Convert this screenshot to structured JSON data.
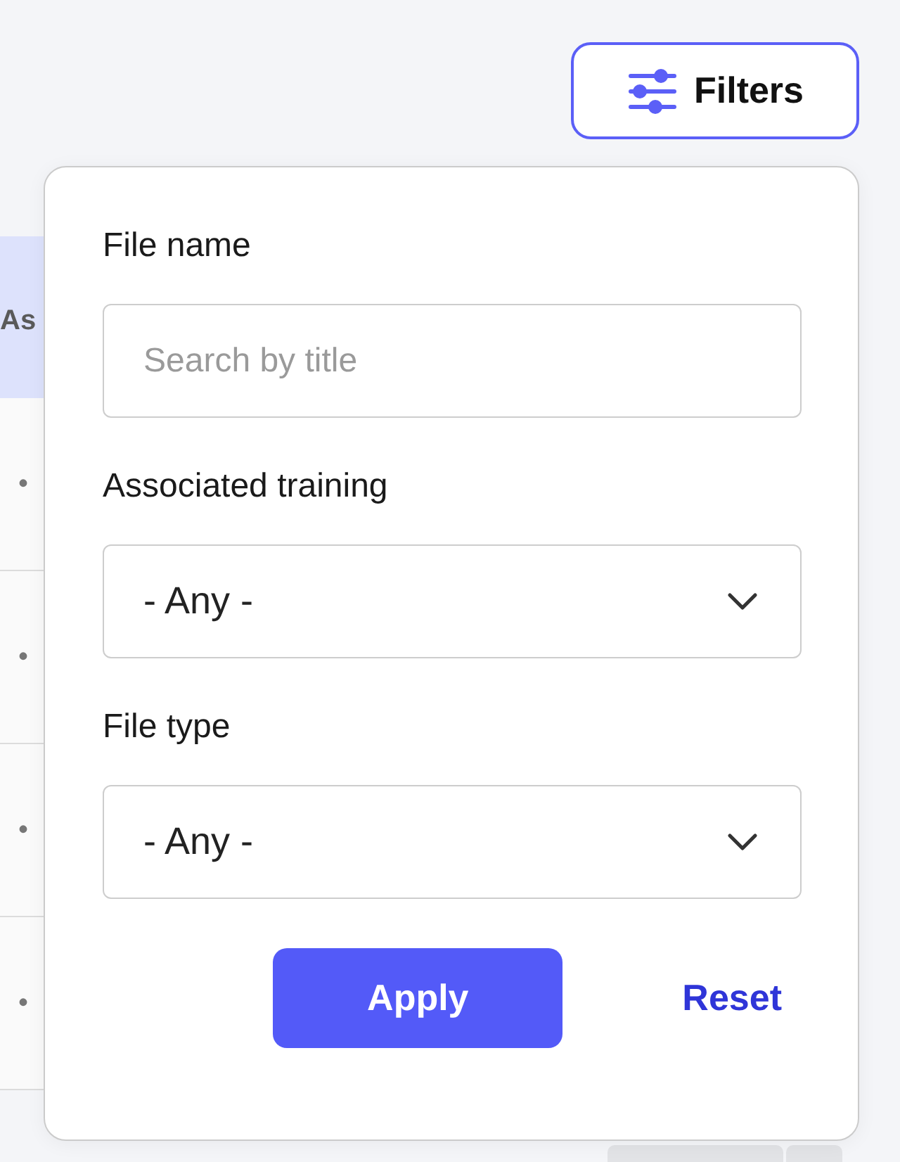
{
  "filter_button": {
    "label": "Filters",
    "expanded": true
  },
  "table": {
    "columns": [
      {
        "label": "As"
      }
    ],
    "rows": [
      {
        "cells": [
          "•"
        ]
      },
      {
        "cells": [
          "•"
        ]
      },
      {
        "cells": [
          "•"
        ]
      },
      {
        "cells": [
          "•"
        ]
      }
    ]
  },
  "filter_panel": {
    "fields": [
      {
        "kind": "text",
        "label": "File name",
        "placeholder": "Search by title"
      },
      {
        "kind": "select",
        "label": "Associated training",
        "value": "- Any -"
      },
      {
        "kind": "select",
        "label": "File type",
        "value": "- Any -"
      }
    ],
    "actions": [
      {
        "kind": "primary",
        "label": "Apply"
      },
      {
        "kind": "link",
        "label": "Reset"
      }
    ]
  }
}
